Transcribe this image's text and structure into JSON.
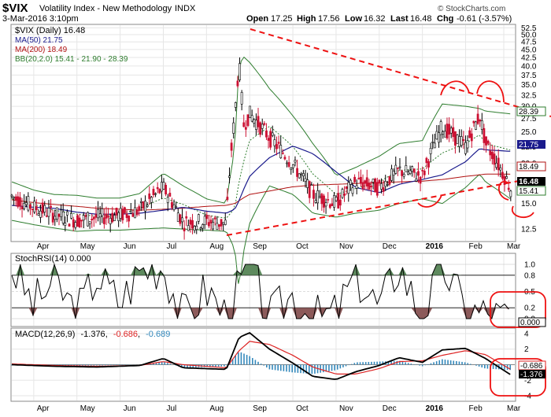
{
  "header": {
    "symbol": "$VIX",
    "name": "Volatility Index - New Methodology",
    "exchange": "INDX",
    "date": "3-Mar-2016 3:10pm",
    "open_label": "Open",
    "open": "17.25",
    "high_label": "High",
    "high": "17.56",
    "low_label": "Low",
    "low": "16.32",
    "last_label": "Last",
    "last": "16.48",
    "chg_label": "Chg",
    "chg": "-0.61 (-3.57%)",
    "watermark": "© StockCharts.com"
  },
  "legend": {
    "price": "$VIX (Daily) 16.48",
    "ma50": "MA(50) 21.75",
    "ma200": "MA(200) 18.49",
    "bb": "BB(20,2.0) 15.41 - 21.90 - 28.39",
    "stoch": "StochRSI(14) 0.000",
    "macd_name": "MACD(12,26,9)",
    "macd_v1": "-1.376",
    "macd_v2": "-0.686",
    "macd_v3": "-0.689"
  },
  "value_tags": {
    "upper": "28.39",
    "ma50": "21.75",
    "ma200": "18.49",
    "last": "16.48",
    "lower": "15.41",
    "stoch": "0.000",
    "macd_signal": "-0.686",
    "macd": "-1.376"
  },
  "colors": {
    "up": "#000000",
    "down": "#cc1133",
    "ma50": "#1a1a8c",
    "ma200": "#b01010",
    "bb": "#2e7d2e",
    "stoch_line": "#000000",
    "stoch_hi_fill": "#5e8a5e",
    "stoch_lo_fill": "#8c5a5a",
    "macd_line": "#000000",
    "macd_signal": "#dd2222",
    "macd_hist": "#3388bb",
    "annotation": "#ee1111"
  },
  "chart_data": [
    {
      "type": "candlestick",
      "title": "$VIX Volatility Index - New Methodology",
      "x_labels": [
        "Apr",
        "May",
        "Jun",
        "Jul",
        "Aug",
        "Sep",
        "Oct",
        "Nov",
        "Dec",
        "2016",
        "Feb",
        "Mar"
      ],
      "y_ticks": [
        12.5,
        15.0,
        17.5,
        20.0,
        22.5,
        25.0,
        27.5,
        30.0,
        32.5,
        35.0,
        37.5,
        40.0,
        42.5,
        45.0,
        47.5,
        50.0,
        52.5
      ],
      "ylim": [
        11.5,
        53.5
      ],
      "scale": "log",
      "x": [
        "Mar-16",
        "Apr-01",
        "Apr-15",
        "May-01",
        "May-15",
        "Jun-01",
        "Jun-15",
        "Jul-01",
        "Jul-15",
        "Aug-01",
        "Aug-15",
        "Aug-21",
        "Aug-24",
        "Aug-27",
        "Sep-01",
        "Sep-15",
        "Oct-01",
        "Oct-15",
        "Nov-01",
        "Nov-15",
        "Dec-01",
        "Dec-15",
        "Jan-01",
        "Jan-15",
        "Feb-01",
        "Feb-11",
        "Feb-15",
        "Mar-03"
      ],
      "close": [
        15.8,
        14.6,
        13.9,
        13.3,
        13.6,
        13.8,
        14.3,
        16.8,
        13.1,
        13.2,
        13.0,
        28.0,
        40.7,
        26.1,
        28.4,
        24.0,
        19.8,
        16.0,
        15.0,
        17.5,
        16.8,
        19.0,
        18.2,
        26.0,
        22.5,
        28.1,
        23.0,
        16.48
      ],
      "ma50": [
        14.8,
        14.6,
        14.5,
        14.1,
        13.9,
        13.9,
        14.0,
        14.3,
        14.6,
        14.2,
        14.0,
        14.4,
        15.3,
        16.5,
        18.2,
        20.8,
        22.6,
        21.4,
        18.8,
        16.8,
        16.2,
        17.2,
        17.8,
        18.4,
        20.2,
        22.2,
        22.0,
        21.75
      ],
      "ma200": [
        15.4,
        15.1,
        14.9,
        14.7,
        14.5,
        14.4,
        14.3,
        14.4,
        14.5,
        14.7,
        14.8,
        15.0,
        15.3,
        15.6,
        16.0,
        16.4,
        16.9,
        17.1,
        17.2,
        17.3,
        17.4,
        17.5,
        17.6,
        17.8,
        18.2,
        18.4,
        18.5,
        18.49
      ],
      "bb_upper": [
        17.5,
        16.5,
        16.0,
        15.9,
        15.6,
        15.6,
        16.1,
        18.6,
        17.0,
        15.5,
        15.0,
        22.0,
        40.0,
        42.8,
        41.0,
        34.0,
        28.0,
        23.0,
        18.3,
        19.4,
        21.0,
        23.0,
        23.5,
        30.5,
        30.0,
        29.5,
        29.0,
        28.39
      ],
      "bb_mid": [
        15.5,
        14.9,
        14.3,
        13.9,
        13.7,
        13.9,
        14.5,
        15.6,
        14.9,
        13.8,
        13.5,
        14.5,
        17.5,
        20.0,
        23.5,
        26.0,
        22.5,
        18.5,
        16.0,
        16.7,
        17.5,
        19.0,
        19.2,
        21.5,
        23.0,
        24.5,
        23.0,
        21.9
      ],
      "bb_lower": [
        13.3,
        12.9,
        12.6,
        12.3,
        12.4,
        12.4,
        12.5,
        12.6,
        12.5,
        12.4,
        12.3,
        10.8,
        8.0,
        10.5,
        13.0,
        17.0,
        16.0,
        14.0,
        13.6,
        14.0,
        14.3,
        15.0,
        15.5,
        15.0,
        16.8,
        18.5,
        17.5,
        15.41
      ]
    },
    {
      "type": "line",
      "title": "StochRSI(14)",
      "y_ticks": [
        0.0,
        0.2,
        0.5,
        0.8,
        1.0
      ],
      "ylim": [
        0,
        1
      ],
      "x": [
        "Mar-16",
        "Apr-01",
        "Apr-15",
        "May-01",
        "May-15",
        "Jun-01",
        "Jun-15",
        "Jul-01",
        "Jul-15",
        "Aug-01",
        "Aug-15",
        "Sep-01",
        "Sep-15",
        "Oct-01",
        "Oct-15",
        "Nov-01",
        "Nov-15",
        "Dec-01",
        "Dec-15",
        "Jan-01",
        "Jan-15",
        "Feb-01",
        "Feb-15",
        "Mar-03"
      ],
      "values": [
        0.95,
        0.25,
        0.7,
        0.1,
        0.8,
        0.3,
        0.9,
        1.0,
        0.0,
        0.55,
        0.05,
        1.0,
        0.0,
        0.45,
        0.0,
        0.1,
        0.8,
        0.2,
        1.0,
        0.0,
        1.0,
        0.15,
        0.1,
        0.0
      ]
    },
    {
      "type": "line",
      "title": "MACD(12,26,9)",
      "y_ticks": [
        -4,
        -2,
        0,
        2,
        4
      ],
      "ylim": [
        -4.5,
        4.5
      ],
      "series": [
        {
          "name": "MACD",
          "x": [
            "Mar-16",
            "Apr-15",
            "May-15",
            "Jun-15",
            "Jul-01",
            "Jul-15",
            "Aug-15",
            "Aug-24",
            "Sep-01",
            "Sep-15",
            "Oct-01",
            "Oct-15",
            "Nov-01",
            "Nov-15",
            "Dec-01",
            "Dec-15",
            "Jan-01",
            "Jan-15",
            "Feb-01",
            "Feb-15",
            "Mar-03"
          ],
          "values": [
            0.0,
            -0.2,
            -0.3,
            -0.1,
            0.8,
            -0.4,
            -0.6,
            3.5,
            4.1,
            2.0,
            0.2,
            -1.5,
            -1.9,
            -0.9,
            -0.1,
            0.9,
            0.3,
            1.9,
            2.1,
            0.8,
            -1.376
          ]
        },
        {
          "name": "Signal",
          "x": [
            "Mar-16",
            "Apr-15",
            "May-15",
            "Jun-15",
            "Jul-01",
            "Jul-15",
            "Aug-15",
            "Aug-24",
            "Sep-01",
            "Sep-15",
            "Oct-01",
            "Oct-15",
            "Nov-01",
            "Nov-15",
            "Dec-01",
            "Dec-15",
            "Jan-01",
            "Jan-15",
            "Feb-01",
            "Feb-15",
            "Mar-03"
          ],
          "values": [
            0.1,
            -0.1,
            -0.2,
            -0.1,
            0.4,
            0.0,
            -0.4,
            1.8,
            3.0,
            2.6,
            1.2,
            -0.3,
            -1.2,
            -1.2,
            -0.5,
            0.4,
            0.5,
            1.2,
            1.8,
            1.3,
            -0.686
          ]
        },
        {
          "name": "Histogram",
          "x": [
            "Mar-16",
            "Apr-15",
            "May-15",
            "Jun-15",
            "Jul-01",
            "Jul-15",
            "Aug-15",
            "Aug-24",
            "Sep-01",
            "Sep-15",
            "Oct-01",
            "Oct-15",
            "Nov-01",
            "Nov-15",
            "Dec-01",
            "Dec-15",
            "Jan-01",
            "Jan-15",
            "Feb-01",
            "Feb-15",
            "Mar-03"
          ],
          "values": [
            -0.1,
            -0.1,
            -0.1,
            0.0,
            0.4,
            -0.4,
            -0.2,
            1.7,
            1.1,
            -0.6,
            -1.0,
            -1.2,
            -0.7,
            0.3,
            0.4,
            0.5,
            -0.2,
            0.7,
            0.3,
            -0.5,
            -0.689
          ]
        }
      ]
    }
  ]
}
